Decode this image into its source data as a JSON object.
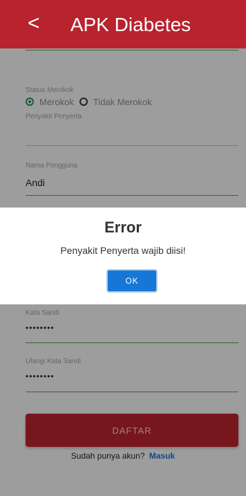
{
  "header": {
    "back_glyph": "<",
    "title": "APK Diabetes"
  },
  "form": {
    "smoking_label": "Status Merokok",
    "smoking_options": [
      "Merokok",
      "Tidak Merokok"
    ],
    "smoking_selected": "Merokok",
    "comorbidity_label": "Penyakit Penyerta",
    "comorbidity_value": "",
    "username_label": "Nama Pengguna",
    "username_value": "Andi",
    "password_label": "Kata Sandi",
    "password_value": "••••••••",
    "confirm_label": "Ulangi Kata Sandi",
    "confirm_value": "••••••••",
    "submit_label": "DAFTAR",
    "signin_prompt": "Sudah punya akun?",
    "signin_link": "Masuk"
  },
  "dialog": {
    "title": "Error",
    "message": "Penyakit Penyerta wajib diisi!",
    "ok_label": "OK"
  },
  "colors": {
    "brand": "#b8232d",
    "underline": "#4a9d4a",
    "dialog_button": "#1677d6",
    "link": "#1f6fd0"
  }
}
